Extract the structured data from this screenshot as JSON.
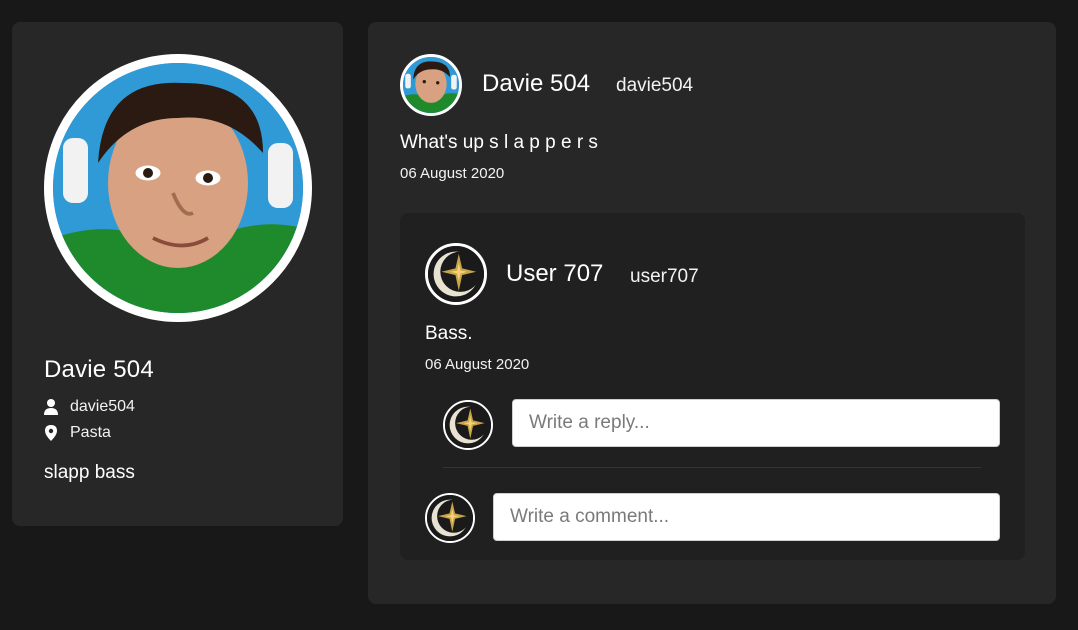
{
  "profile": {
    "name": "Davie 504",
    "handle": "davie504",
    "location": "Pasta",
    "bio": "slapp bass",
    "avatar_icon": "user-photo",
    "handle_icon": "user-icon",
    "location_icon": "map-pin-icon"
  },
  "post": {
    "author_name": "Davie 504",
    "author_handle": "davie504",
    "text": "What's up s l a p p e r s",
    "date": "06 August 2020",
    "comment": {
      "author_name": "User 707",
      "author_handle": "user707",
      "text": "Bass.",
      "date": "06 August 2020",
      "avatar_icon": "star-moon-emblem",
      "reply_placeholder": "Write a reply..."
    },
    "comment_placeholder": "Write a comment..."
  },
  "colors": {
    "page_bg": "#181818",
    "card_bg": "#272727",
    "comment_bg": "#202020",
    "text": "#ffffff"
  }
}
